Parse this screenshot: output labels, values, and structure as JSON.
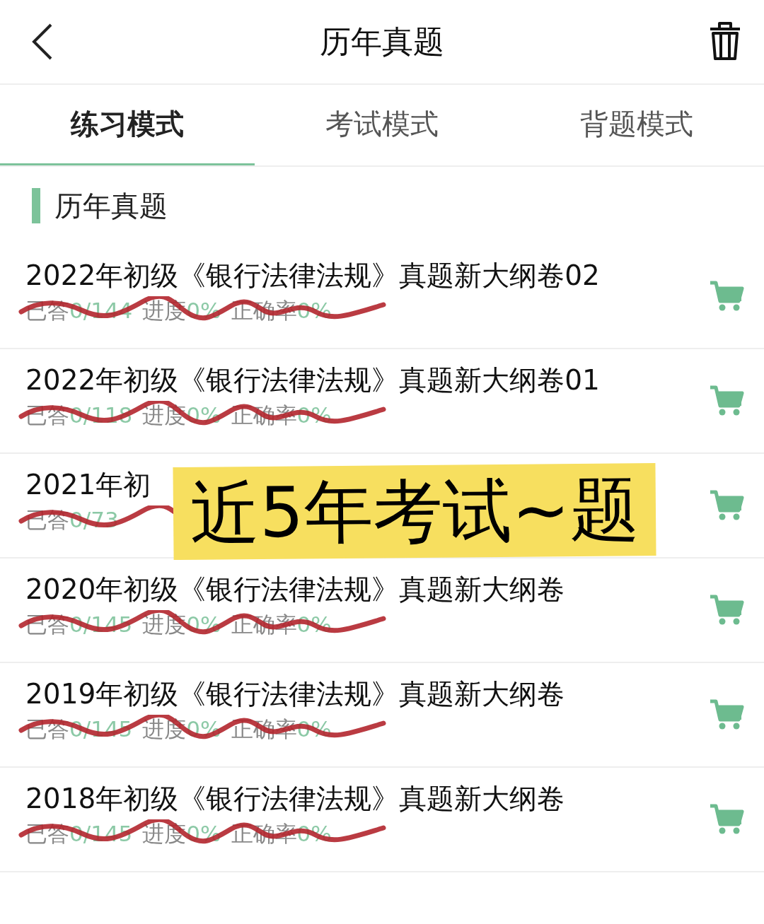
{
  "header": {
    "title": "历年真题"
  },
  "tabs": [
    {
      "label": "练习模式",
      "selected": true
    },
    {
      "label": "考试模式",
      "selected": false
    },
    {
      "label": "背题模式",
      "selected": false
    }
  ],
  "section": {
    "title": "历年真题"
  },
  "papers": [
    {
      "title": "2022年初级《银行法律法规》真题新大纲卷02",
      "scribbled": true,
      "stats": [
        {
          "label": "已答",
          "value": "0/144"
        },
        {
          "label": "进度",
          "value": "0%"
        },
        {
          "label": "正确率",
          "value": "0%"
        }
      ]
    },
    {
      "title": "2022年初级《银行法律法规》真题新大纲卷01",
      "scribbled": true,
      "stats": [
        {
          "label": "已答",
          "value": "0/118"
        },
        {
          "label": "进度",
          "value": "0%"
        },
        {
          "label": "正确率",
          "value": "0%"
        }
      ]
    },
    {
      "title": "2021年初",
      "scribbled": true,
      "stats": [
        {
          "label": "已答",
          "value": "0/73"
        }
      ]
    },
    {
      "title": "2020年初级《银行法律法规》真题新大纲卷",
      "scribbled": true,
      "stats": [
        {
          "label": "已答",
          "value": "0/145"
        },
        {
          "label": "进度",
          "value": "0%"
        },
        {
          "label": "正确率",
          "value": "0%"
        }
      ]
    },
    {
      "title": "2019年初级《银行法律法规》真题新大纲卷",
      "scribbled": true,
      "stats": [
        {
          "label": "已答",
          "value": "0/145"
        },
        {
          "label": "进度",
          "value": "0%"
        },
        {
          "label": "正确率",
          "value": "0%"
        }
      ]
    },
    {
      "title": "2018年初级《银行法律法规》真题新大纲卷",
      "scribbled": true,
      "stats": [
        {
          "label": "已答",
          "value": "0/145"
        },
        {
          "label": "进度",
          "value": "0%"
        },
        {
          "label": "正确率",
          "value": "0%"
        }
      ]
    }
  ],
  "sticker": {
    "text": "近5年考试~题"
  }
}
